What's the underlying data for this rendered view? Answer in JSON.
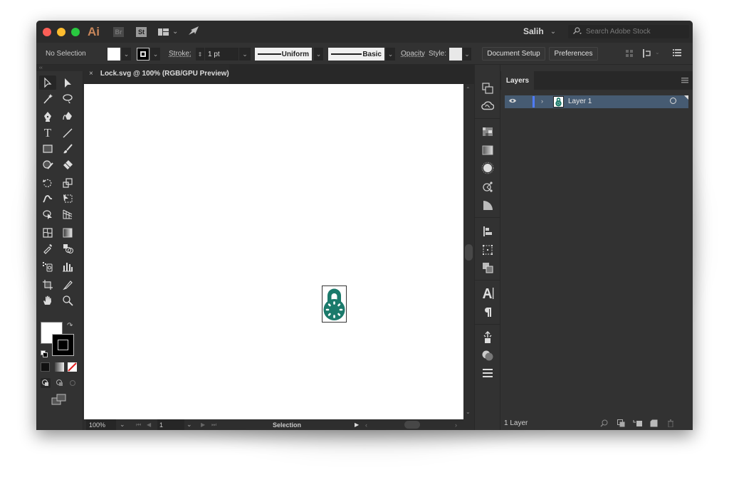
{
  "titlebar": {
    "app_logo": "Ai",
    "bridge_label": "Br",
    "stock_label": "St",
    "workspace_icon": "workspace-layout-icon",
    "publish_icon": "rocket-icon",
    "user_name": "Salih",
    "search_placeholder": "Search Adobe Stock"
  },
  "controlbar": {
    "selection_status": "No Selection",
    "stroke_label": "Stroke:",
    "stroke_weight": "1 pt",
    "variable_width_profile": "Uniform",
    "brush_definition": "Basic",
    "opacity_label": "Opacity",
    "style_label": "Style:",
    "document_setup_label": "Document Setup",
    "preferences_label": "Preferences"
  },
  "document": {
    "tab_title": "Lock.svg @ 100% (RGB/GPU Preview)",
    "close_glyph": "×",
    "artwork_color": "#1b7a6b"
  },
  "statusbar": {
    "zoom": "100%",
    "artboard": "1",
    "current_tool": "Selection"
  },
  "toolbox": {
    "fill_color": "#ffffff",
    "stroke_color": "#000000"
  },
  "layers_panel": {
    "tab_label": "Layers",
    "layers": [
      {
        "name": "Layer 1",
        "visible": true,
        "color": "#4f7cff",
        "selected": true
      }
    ],
    "footer_count": "1 Layer"
  },
  "collapse": {
    "left": "‹‹",
    "right": "››"
  }
}
